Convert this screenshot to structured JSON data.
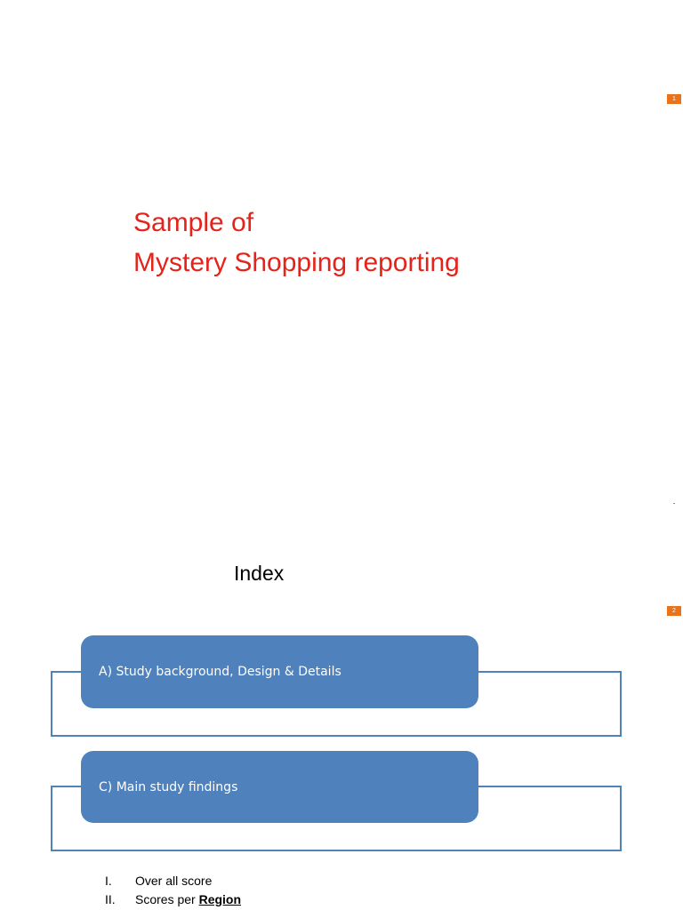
{
  "slide1": {
    "page_number": "1",
    "title_line1": "Sample of",
    "title_line2": "Mystery Shopping reporting"
  },
  "slide2": {
    "page_number": "2",
    "heading": "Index",
    "boxes": [
      {
        "label": "A) Study background, Design & Details"
      },
      {
        "label": "C) Main study findings"
      }
    ],
    "list": [
      {
        "numeral": "I.",
        "text": "Over all score",
        "emphasis": ""
      },
      {
        "numeral": "II.",
        "text": "Scores per ",
        "emphasis": "Region"
      }
    ]
  },
  "colors": {
    "title": "#e5231b",
    "badge": "#e8731a",
    "box": "#4f81bd"
  }
}
